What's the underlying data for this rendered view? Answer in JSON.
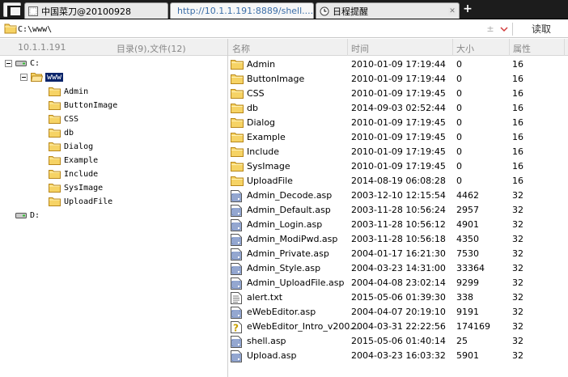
{
  "tabs": [
    {
      "title": "中国菜刀@20100928"
    },
    {
      "title": "http://10.1.1.191:8889/shell...."
    },
    {
      "title": "日程提醒"
    }
  ],
  "new_tab_label": "+",
  "address": {
    "value": "C:\\www\\",
    "stepper": "±",
    "read_button": "读取"
  },
  "header": {
    "host": "10.1.1.191",
    "summary": "目录(9),文件(12)",
    "col_name": "名称",
    "col_time": "时间",
    "col_size": "大小",
    "col_attr": "属性"
  },
  "tree": {
    "drive_c": "C:",
    "www": "www",
    "folders": [
      "Admin",
      "ButtonImage",
      "CSS",
      "db",
      "Dialog",
      "Example",
      "Include",
      "SysImage",
      "UploadFile"
    ],
    "drive_d": "D:"
  },
  "files": [
    {
      "icon": "folder-icon",
      "name": "Admin",
      "time": "2010-01-09 17:19:44",
      "size": "0",
      "attr": "16"
    },
    {
      "icon": "folder-icon",
      "name": "ButtonImage",
      "time": "2010-01-09 17:19:44",
      "size": "0",
      "attr": "16"
    },
    {
      "icon": "folder-icon",
      "name": "CSS",
      "time": "2010-01-09 17:19:45",
      "size": "0",
      "attr": "16"
    },
    {
      "icon": "folder-icon",
      "name": "db",
      "time": "2014-09-03 02:52:44",
      "size": "0",
      "attr": "16"
    },
    {
      "icon": "folder-icon",
      "name": "Dialog",
      "time": "2010-01-09 17:19:45",
      "size": "0",
      "attr": "16"
    },
    {
      "icon": "folder-icon",
      "name": "Example",
      "time": "2010-01-09 17:19:45",
      "size": "0",
      "attr": "16"
    },
    {
      "icon": "folder-icon",
      "name": "Include",
      "time": "2010-01-09 17:19:45",
      "size": "0",
      "attr": "16"
    },
    {
      "icon": "folder-icon",
      "name": "SysImage",
      "time": "2010-01-09 17:19:45",
      "size": "0",
      "attr": "16"
    },
    {
      "icon": "folder-icon",
      "name": "UploadFile",
      "time": "2014-08-19 06:08:28",
      "size": "0",
      "attr": "16"
    },
    {
      "icon": "asp-file-icon",
      "name": "Admin_Decode.asp",
      "time": "2003-12-10 12:15:54",
      "size": "4462",
      "attr": "32"
    },
    {
      "icon": "asp-file-icon",
      "name": "Admin_Default.asp",
      "time": "2003-11-28 10:56:24",
      "size": "2957",
      "attr": "32"
    },
    {
      "icon": "asp-file-icon",
      "name": "Admin_Login.asp",
      "time": "2003-11-28 10:56:12",
      "size": "4901",
      "attr": "32"
    },
    {
      "icon": "asp-file-icon",
      "name": "Admin_ModiPwd.asp",
      "time": "2003-11-28 10:56:18",
      "size": "4350",
      "attr": "32"
    },
    {
      "icon": "asp-file-icon",
      "name": "Admin_Private.asp",
      "time": "2004-01-17 16:21:30",
      "size": "7530",
      "attr": "32"
    },
    {
      "icon": "asp-file-icon",
      "name": "Admin_Style.asp",
      "time": "2004-03-23 14:31:00",
      "size": "33364",
      "attr": "32"
    },
    {
      "icon": "asp-file-icon",
      "name": "Admin_UploadFile.asp",
      "time": "2004-04-08 23:02:14",
      "size": "9299",
      "attr": "32"
    },
    {
      "icon": "text-file-icon",
      "name": "alert.txt",
      "time": "2015-05-06 01:39:30",
      "size": "338",
      "attr": "32"
    },
    {
      "icon": "asp-file-icon",
      "name": "eWebEditor.asp",
      "time": "2004-04-07 20:19:10",
      "size": "9191",
      "attr": "32"
    },
    {
      "icon": "unknown-file-icon",
      "name": "eWebEditor_Intro_v200....",
      "time": "2004-03-31 22:22:56",
      "size": "174169",
      "attr": "32"
    },
    {
      "icon": "asp-file-icon",
      "name": "shell.asp",
      "time": "2015-05-06 01:40:14",
      "size": "25",
      "attr": "32"
    },
    {
      "icon": "asp-file-icon",
      "name": "Upload.asp",
      "time": "2004-03-23 16:03:32",
      "size": "5901",
      "attr": "32"
    }
  ]
}
